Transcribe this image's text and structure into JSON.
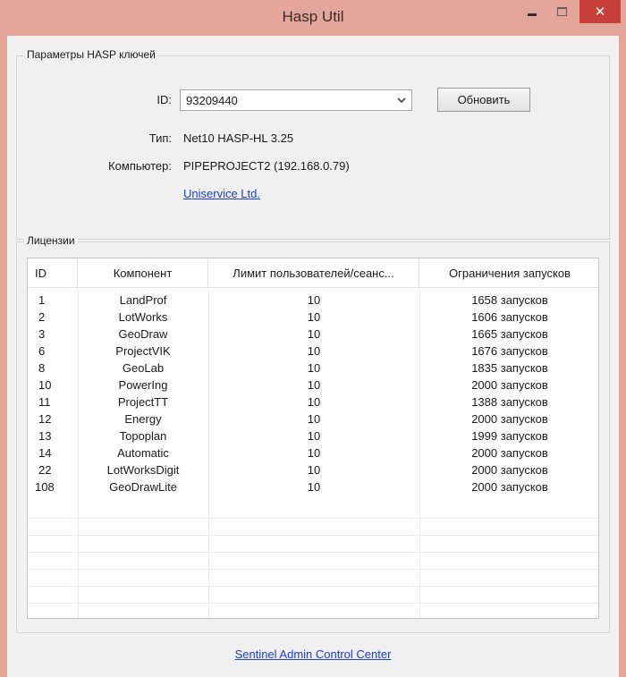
{
  "window": {
    "title": "Hasp Util"
  },
  "params": {
    "group_title": "Параметры HASP ключей",
    "id_label": "ID:",
    "id_value": "93209440",
    "refresh_label": "Обновить",
    "type_label": "Тип:",
    "type_value": "Net10 HASP-HL 3.25",
    "computer_label": "Компьютер:",
    "computer_value": "PIPEPROJECT2 (192.168.0.79)",
    "vendor_link": "Uniservice Ltd."
  },
  "licenses": {
    "group_title": "Лицензии",
    "columns": [
      "ID",
      "Компонент",
      "Лимит пользователей/сеанс...",
      "Ограничения запусков"
    ],
    "rows": [
      {
        "id": "1",
        "component": "LandProf",
        "limit": "10",
        "runs": "1658 запусков"
      },
      {
        "id": "2",
        "component": "LotWorks",
        "limit": "10",
        "runs": "1606 запусков"
      },
      {
        "id": "3",
        "component": "GeoDraw",
        "limit": "10",
        "runs": "1665 запусков"
      },
      {
        "id": "6",
        "component": "ProjectVIK",
        "limit": "10",
        "runs": "1676 запусков"
      },
      {
        "id": "8",
        "component": "GeoLab",
        "limit": "10",
        "runs": "1835 запусков"
      },
      {
        "id": "10",
        "component": "PowerIng",
        "limit": "10",
        "runs": "2000 запусков"
      },
      {
        "id": "11",
        "component": "ProjectTT",
        "limit": "10",
        "runs": "1388 запусков"
      },
      {
        "id": "12",
        "component": "Energy",
        "limit": "10",
        "runs": "2000 запусков"
      },
      {
        "id": "13",
        "component": "Topoplan",
        "limit": "10",
        "runs": "1999 запусков"
      },
      {
        "id": "14",
        "component": "Automatic",
        "limit": "10",
        "runs": "2000 запусков"
      },
      {
        "id": "22",
        "component": "LotWorksDigit",
        "limit": "10",
        "runs": "2000 запусков"
      },
      {
        "id": "108",
        "component": "GeoDrawLite",
        "limit": "10",
        "runs": "2000 запусков"
      }
    ]
  },
  "footer": {
    "link": "Sentinel Admin Control Center"
  },
  "icons": {
    "minimize": "minimize-icon",
    "maximize": "maximize-icon",
    "close": "close-icon",
    "dropdown": "chevron-down-icon"
  },
  "colors": {
    "titlebar": "#e4a69b",
    "close_button": "#c7403a",
    "link": "#1a3dd6",
    "client_bg": "#f0f0f0"
  }
}
